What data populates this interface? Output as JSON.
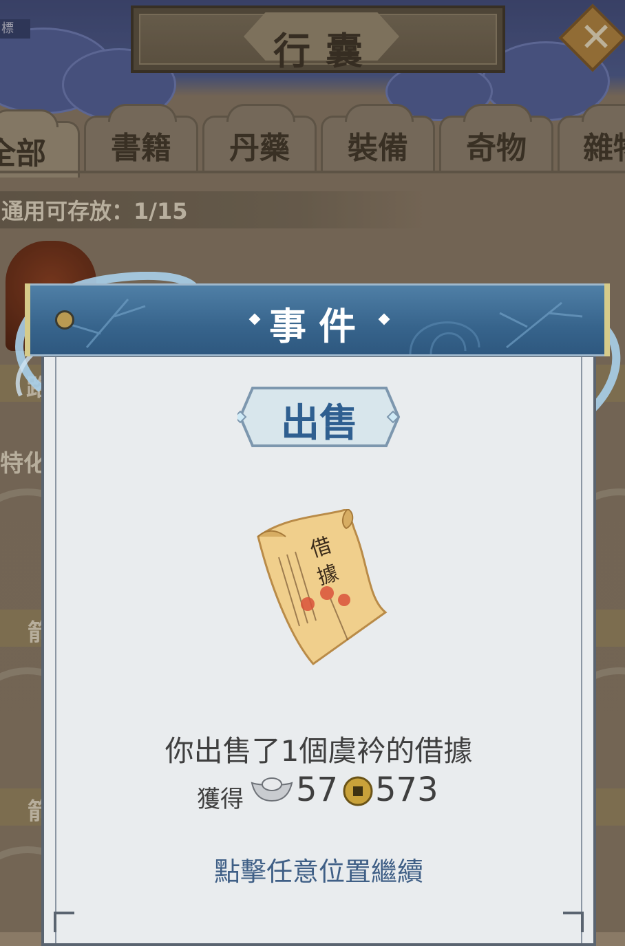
{
  "bag": {
    "title": "行囊",
    "corner_tag": "標",
    "tabs": [
      {
        "label": "全部",
        "active": true
      },
      {
        "label": "書籍",
        "active": false
      },
      {
        "label": "丹藥",
        "active": false
      },
      {
        "label": "裝備",
        "active": false
      },
      {
        "label": "奇物",
        "active": false
      },
      {
        "label": "雜物",
        "active": false
      }
    ],
    "capacity_text": "通用可存放：1/15",
    "side_labels": [
      "路",
      "特化",
      "箭",
      "箭"
    ],
    "close_icon": "close-icon"
  },
  "event": {
    "title": "事件",
    "badge": "出售",
    "item_icon": "loan-receipt-scroll-icon",
    "message": "你出售了1個虞衿的借據",
    "gain_label": "獲得",
    "silver_icon": "silver-ingot-icon",
    "silver_amount": "57",
    "coin_icon": "copper-coin-icon",
    "coin_amount": "573",
    "continue_hint": "點擊任意位置繼續"
  },
  "colors": {
    "header_blue": "#37648c",
    "badge_text": "#2f5f90",
    "panel_bg": "#e9ecee",
    "hint_text": "#3f5f86"
  }
}
